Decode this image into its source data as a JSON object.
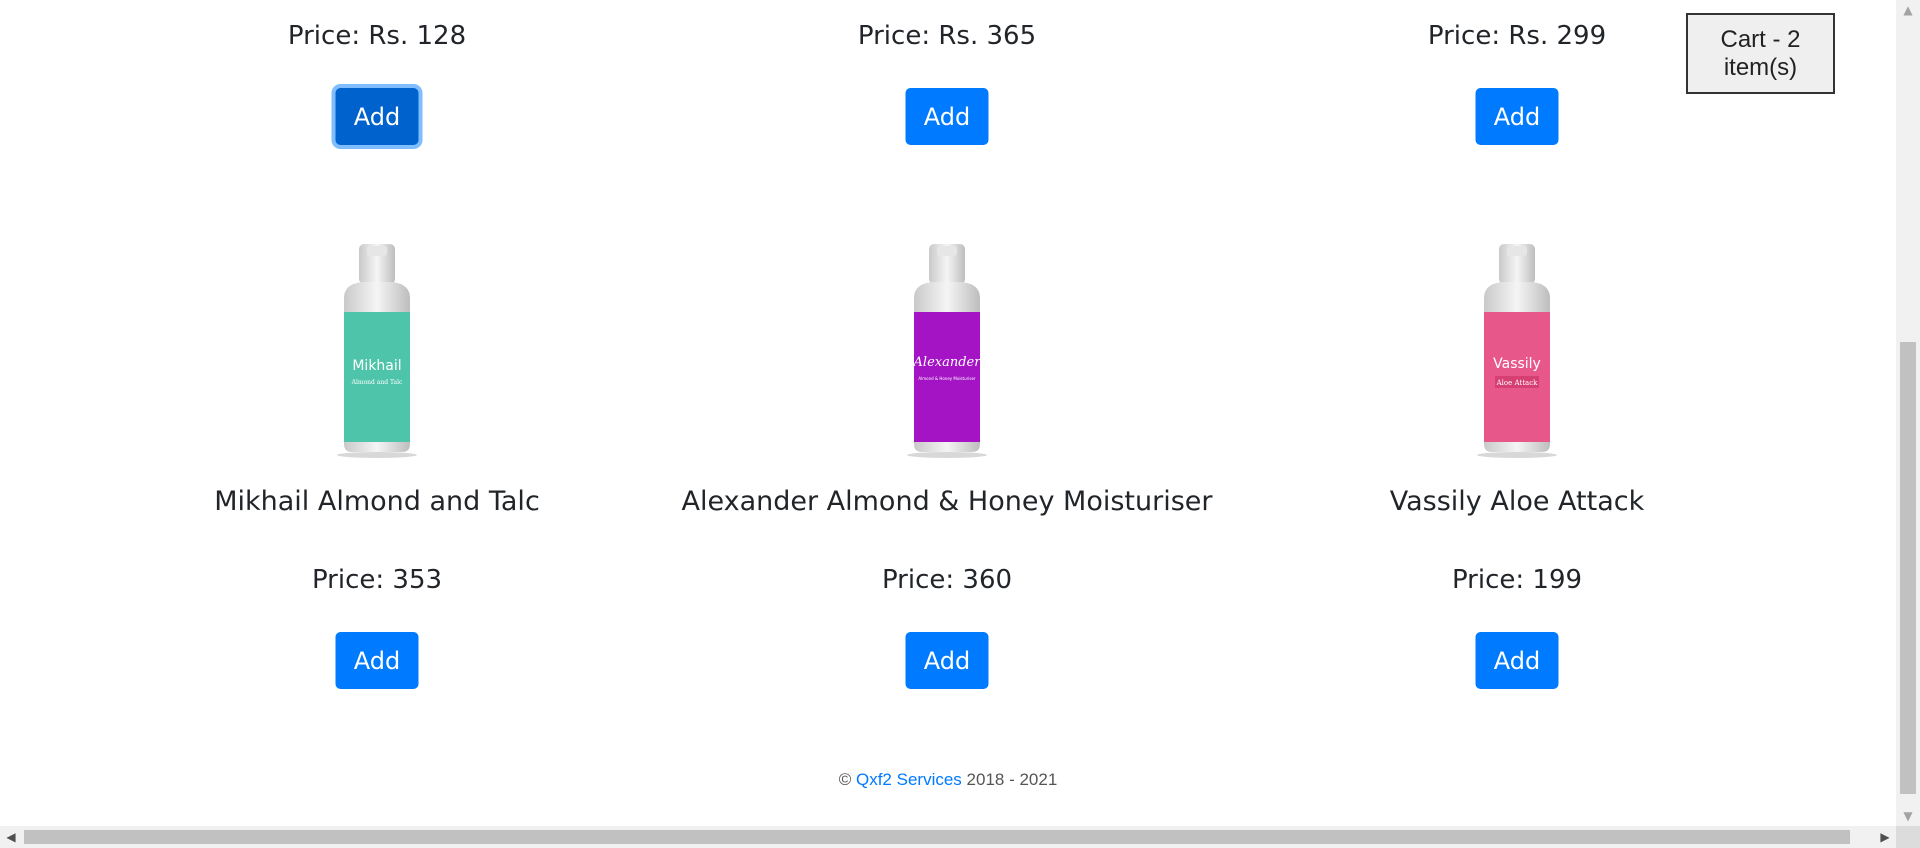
{
  "cart": {
    "label": "Cart - 2 item(s)"
  },
  "row1": [
    {
      "price": "Price: Rs. 128",
      "add_label": "Add"
    },
    {
      "price": "Price: Rs. 365",
      "add_label": "Add"
    },
    {
      "price": "Price: Rs. 299",
      "add_label": "Add"
    }
  ],
  "row2": [
    {
      "name": "Mikhail Almond and Talc",
      "price": "Price: 353",
      "add_label": "Add",
      "bottle_color": "#4ec4aa",
      "label_brand": "Mikhail",
      "label_sub": "Almond and Talc"
    },
    {
      "name": "Alexander Almond & Honey Moisturiser",
      "price": "Price: 360",
      "add_label": "Add",
      "bottle_color": "#a414c4",
      "label_brand": "Alexander",
      "label_sub": "Almond & Honey Moisturiser"
    },
    {
      "name": "Vassily Aloe Attack",
      "price": "Price: 199",
      "add_label": "Add",
      "bottle_color": "#e8578a",
      "label_brand": "Vassily",
      "label_sub": "Aloe Attack"
    }
  ],
  "footer": {
    "copyright": "©",
    "company": "Qxf2 Services",
    "years": "2018 - 2021"
  },
  "icons": {
    "scroll_up": "triangle-up-icon",
    "scroll_down": "triangle-down-icon",
    "scroll_left": "triangle-left-icon",
    "scroll_right": "triangle-right-icon"
  }
}
